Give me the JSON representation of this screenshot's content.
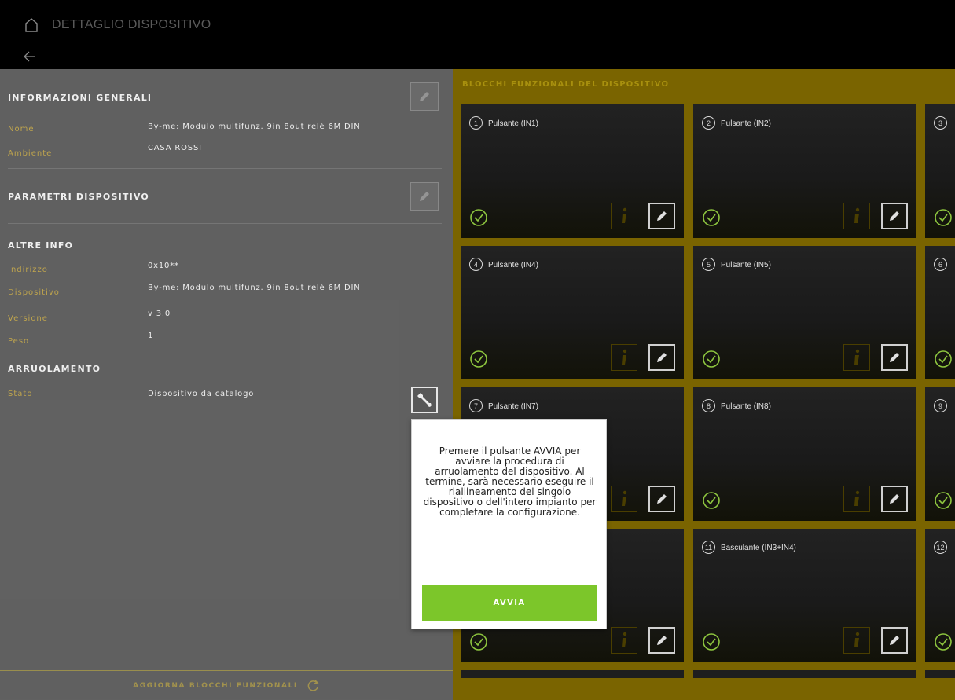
{
  "topbar": {
    "title": "DETTAGLIO DISPOSITIVO"
  },
  "general": {
    "title": "INFORMAZIONI GENERALI",
    "rows": [
      {
        "label": "Nome",
        "value": "By-me: Modulo multifunz. 9in 8out relè 6M DIN"
      },
      {
        "label": "Ambiente",
        "value": "CASA ROSSI"
      }
    ]
  },
  "params": {
    "title": "PARAMETRI DISPOSITIVO"
  },
  "other": {
    "title": "ALTRE INFO",
    "rows": [
      {
        "label": "Indirizzo",
        "value": "0x10**"
      },
      {
        "label": "Dispositivo",
        "value": "By-me: Modulo multifunz. 9in 8out relè 6M DIN"
      },
      {
        "label": "Versione",
        "value": "v 3.0"
      },
      {
        "label": "Peso",
        "value": "1"
      }
    ]
  },
  "enroll": {
    "title": "ARRUOLAMENTO",
    "rows": [
      {
        "label": "Stato",
        "value": "Dispositivo da catalogo"
      }
    ]
  },
  "footer": {
    "refresh_label": "AGGIORNA BLOCCHI FUNZIONALI"
  },
  "blocks": {
    "title": "BLOCCHI FUNZIONALI DEL DISPOSITIVO",
    "cards": [
      {
        "num": "1",
        "label": "Pulsante (IN1)"
      },
      {
        "num": "2",
        "label": "Pulsante (IN2)"
      },
      {
        "num": "3",
        "label": ""
      },
      {
        "num": "4",
        "label": "Pulsante (IN4)"
      },
      {
        "num": "5",
        "label": "Pulsante (IN5)"
      },
      {
        "num": "6",
        "label": ""
      },
      {
        "num": "7",
        "label": "Pulsante (IN7)"
      },
      {
        "num": "8",
        "label": "Pulsante (IN8)"
      },
      {
        "num": "9",
        "label": ""
      },
      {
        "num": "",
        "label": ""
      },
      {
        "num": "11",
        "label": "Basculante (IN3+IN4)"
      },
      {
        "num": "12",
        "label": ""
      }
    ]
  },
  "popup": {
    "text": "Premere il pulsante AVVIA per avviare la procedura di arruolamento del dispositivo. Al termine, sarà necessario eseguire il riallineamento del singolo dispositivo o dell'intero impianto per completare la configurazione.",
    "button_label": "AVVIA"
  },
  "colors": {
    "accent": "#a57f00",
    "panel_bg": "#7a6400",
    "button_green": "#7cc62a"
  }
}
